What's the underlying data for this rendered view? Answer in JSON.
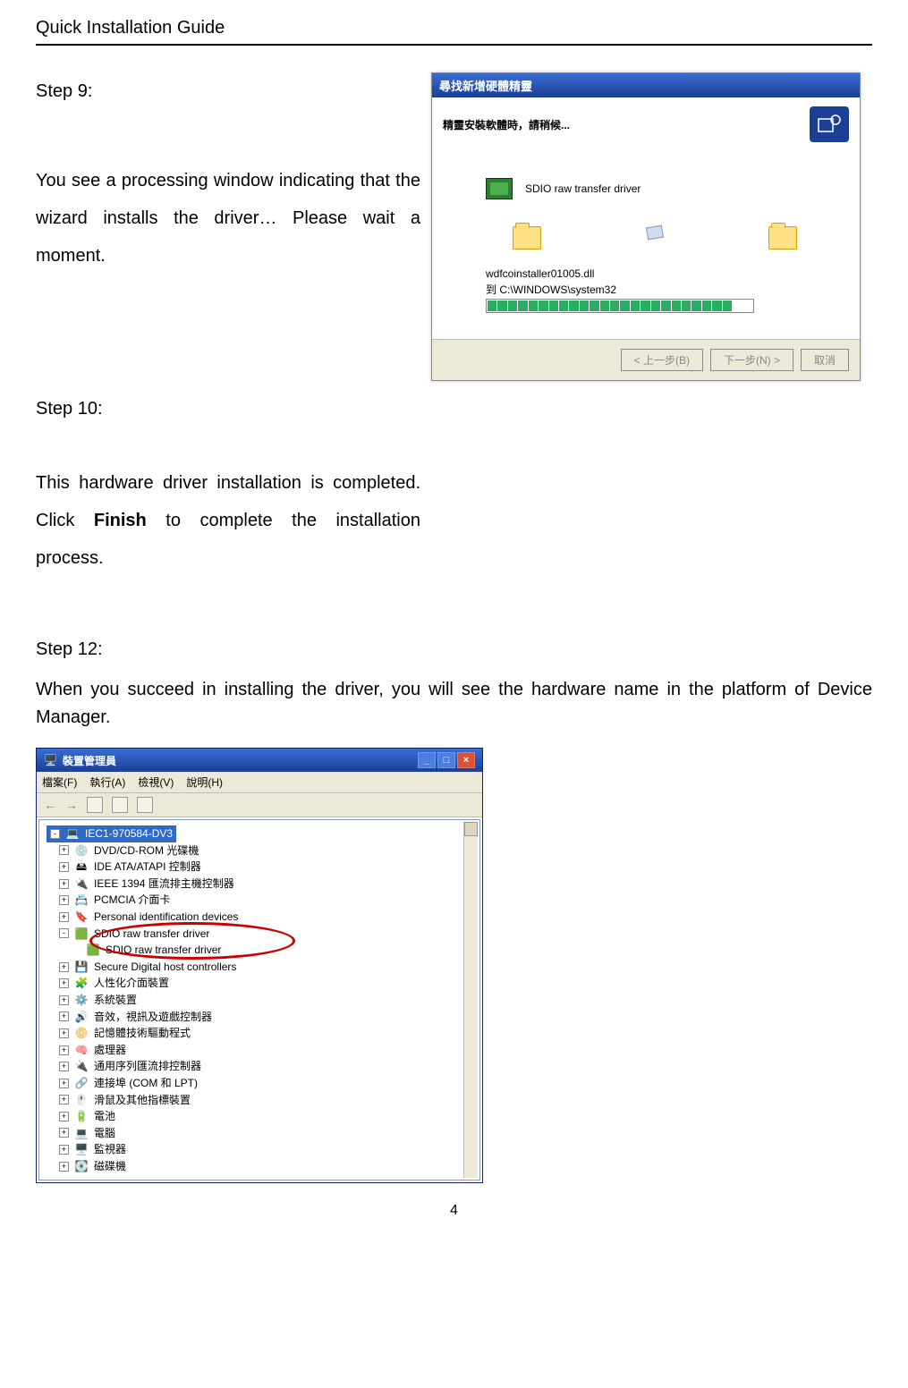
{
  "doc_header": "Quick Installation Guide",
  "page_number": "4",
  "s9": {
    "label": "Step 9:",
    "text": "You see a processing window indicating that the wizard installs the driver… Please wait a moment."
  },
  "s10": {
    "label": "Step 10:",
    "text_pre": "This hardware driver installation is completed. Click ",
    "text_bold": "Finish",
    "text_post": " to complete the installation process."
  },
  "s12": {
    "label": "Step 12:",
    "text": "When you succeed in installing the driver, you will see the hardware name in the platform of Device Manager."
  },
  "wizard": {
    "title": "尋找新增硬體精靈",
    "subtitle": "精靈安裝軟體時，請稍候...",
    "driver_name": "SDIO raw transfer driver",
    "file_line1": "wdfcoinstaller01005.dll",
    "file_line2": "到 C:\\WINDOWS\\system32",
    "btn_back": "< 上一步(B)",
    "btn_next": "下一步(N) >",
    "btn_cancel": "取消"
  },
  "devmgr": {
    "title": "裝置管理員",
    "menu_file": "檔案(F)",
    "menu_action": "執行(A)",
    "menu_view": "檢視(V)",
    "menu_help": "說明(H)",
    "root": "IEC1-970584-DV3",
    "nodes": [
      "DVD/CD-ROM 光碟機",
      "IDE ATA/ATAPI 控制器",
      "IEEE 1394 匯流排主機控制器",
      "PCMCIA 介面卡",
      "Personal identification devices"
    ],
    "sdio_parent": "SDIO raw transfer driver",
    "sdio_child": "SDIO raw transfer driver",
    "nodes2": [
      "Secure Digital host controllers",
      "人性化介面裝置",
      "系統裝置",
      "音效，視訊及遊戲控制器",
      "記憶體技術驅動程式",
      "處理器",
      "通用序列匯流排控制器",
      "連接埠 (COM 和 LPT)",
      "滑鼠及其他指標裝置",
      "電池",
      "電腦",
      "監視器",
      "磁碟機"
    ]
  }
}
